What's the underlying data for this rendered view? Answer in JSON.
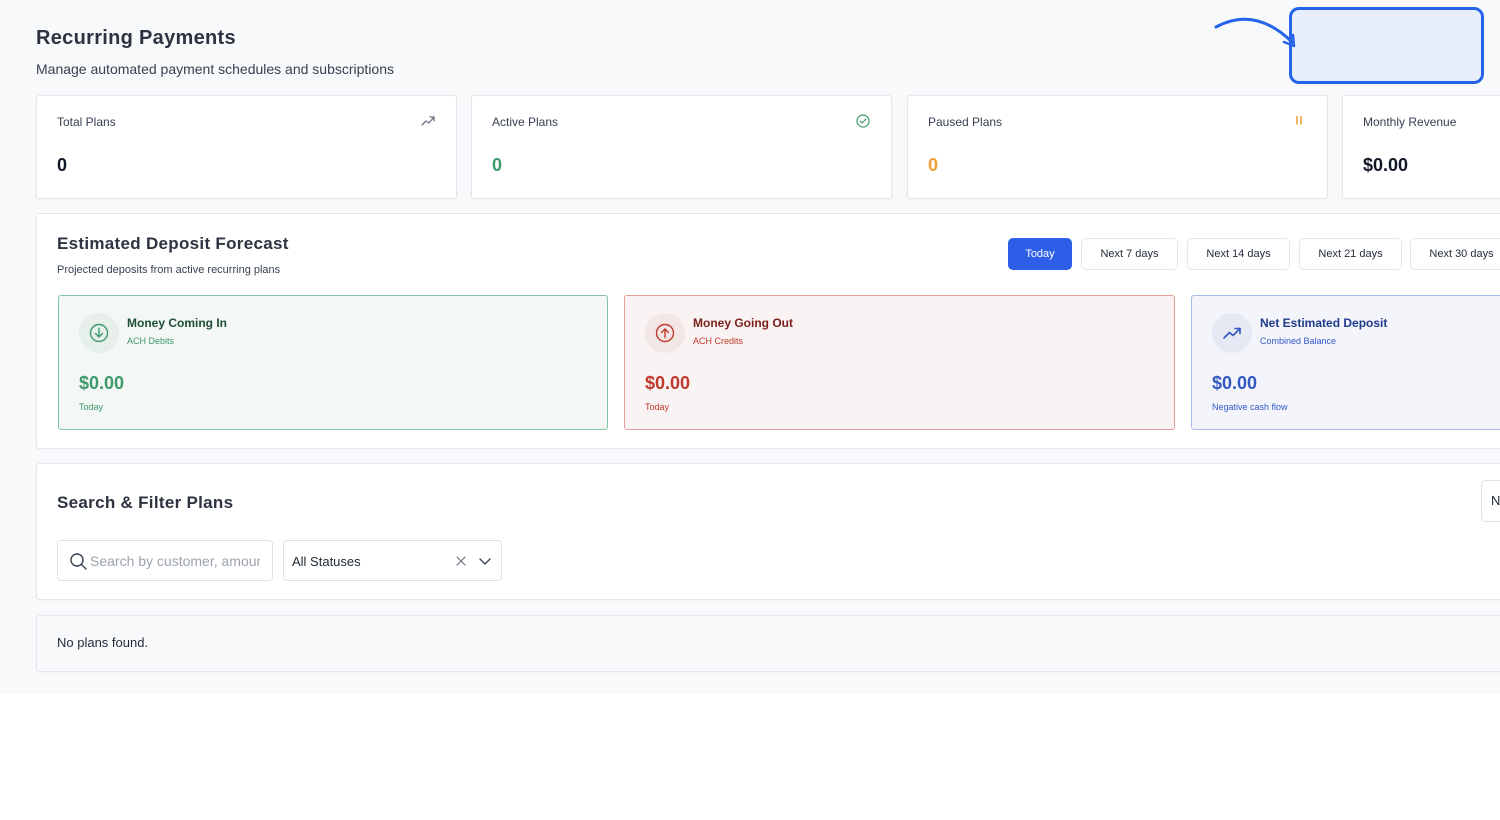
{
  "header": {
    "title": "Recurring Payments",
    "subtitle": "Manage automated payment schedules and subscriptions"
  },
  "stats": [
    {
      "label": "Total Plans",
      "value": "0",
      "icon": "trending-up-icon",
      "color": "#111827"
    },
    {
      "label": "Active Plans",
      "value": "0",
      "icon": "check-circle-icon",
      "color": "#3d9a6a"
    },
    {
      "label": "Paused Plans",
      "value": "0",
      "icon": "pause-icon",
      "color": "#f0a030"
    },
    {
      "label": "Monthly Revenue",
      "value": "$0.00",
      "icon": "",
      "color": "#111827"
    }
  ],
  "forecast": {
    "title": "Estimated Deposit Forecast",
    "subtitle": "Projected deposits from active recurring plans",
    "ranges": [
      "Today",
      "Next 7 days",
      "Next 14 days",
      "Next 21 days",
      "Next 30 days"
    ],
    "active_range": "Today",
    "cards": {
      "in": {
        "title": "Money Coming In",
        "sub": "ACH Debits",
        "value": "$0.00",
        "note": "Today",
        "icon": "arrow-down-circle-icon"
      },
      "out": {
        "title": "Money Going Out",
        "sub": "ACH Credits",
        "value": "$0.00",
        "note": "Today",
        "icon": "arrow-up-circle-icon"
      },
      "net": {
        "title": "Net Estimated Deposit",
        "sub": "Combined Balance",
        "value": "$0.00",
        "note": "Negative cash flow",
        "icon": "trending-up-icon"
      }
    }
  },
  "filters": {
    "title": "Search & Filter Plans",
    "search_placeholder": "Search by customer, amount",
    "status_value": "All Statuses",
    "side_button_label": "N"
  },
  "empty": {
    "message": "No plans found."
  },
  "colors": {
    "accent": "#2c5ee8",
    "positive": "#3d9a6a",
    "negative": "#c0392b",
    "warning": "#f0a030",
    "net": "#3358c4"
  }
}
